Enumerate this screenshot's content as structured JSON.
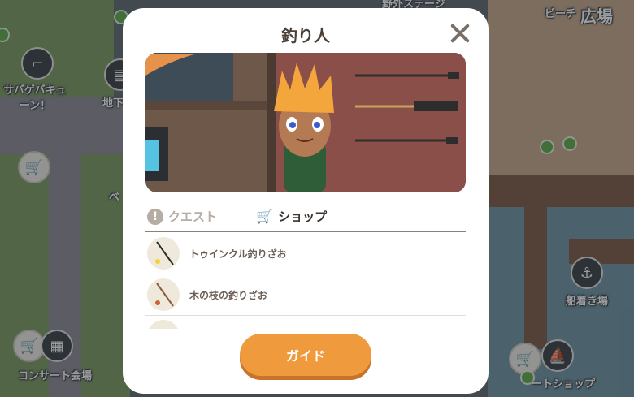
{
  "map": {
    "labels": {
      "survival_game": "サバゲバキューン！",
      "underground": "地下",
      "concert_hall": "コンサート会場",
      "outdoor_stage": "野外ステージ",
      "beach": "ビーチ",
      "plaza": "広場",
      "dock": "船着き場",
      "boat_shop": "ートショップ",
      "partial_be": "ベ"
    }
  },
  "dialog": {
    "title": "釣り人",
    "tabs": {
      "quest": "クエスト",
      "shop": "ショップ"
    },
    "shop_items": [
      {
        "name": "トゥインクル釣りざお",
        "icon": "twinkle-rod-icon"
      },
      {
        "name": "木の枝の釣りざお",
        "icon": "branch-rod-icon"
      },
      {
        "name": "",
        "icon": "rod-icon"
      }
    ],
    "guide_button": "ガイド"
  },
  "colors": {
    "accent": "#f09a3e",
    "title_text": "#4b4038",
    "map_green": "#5fae45"
  }
}
